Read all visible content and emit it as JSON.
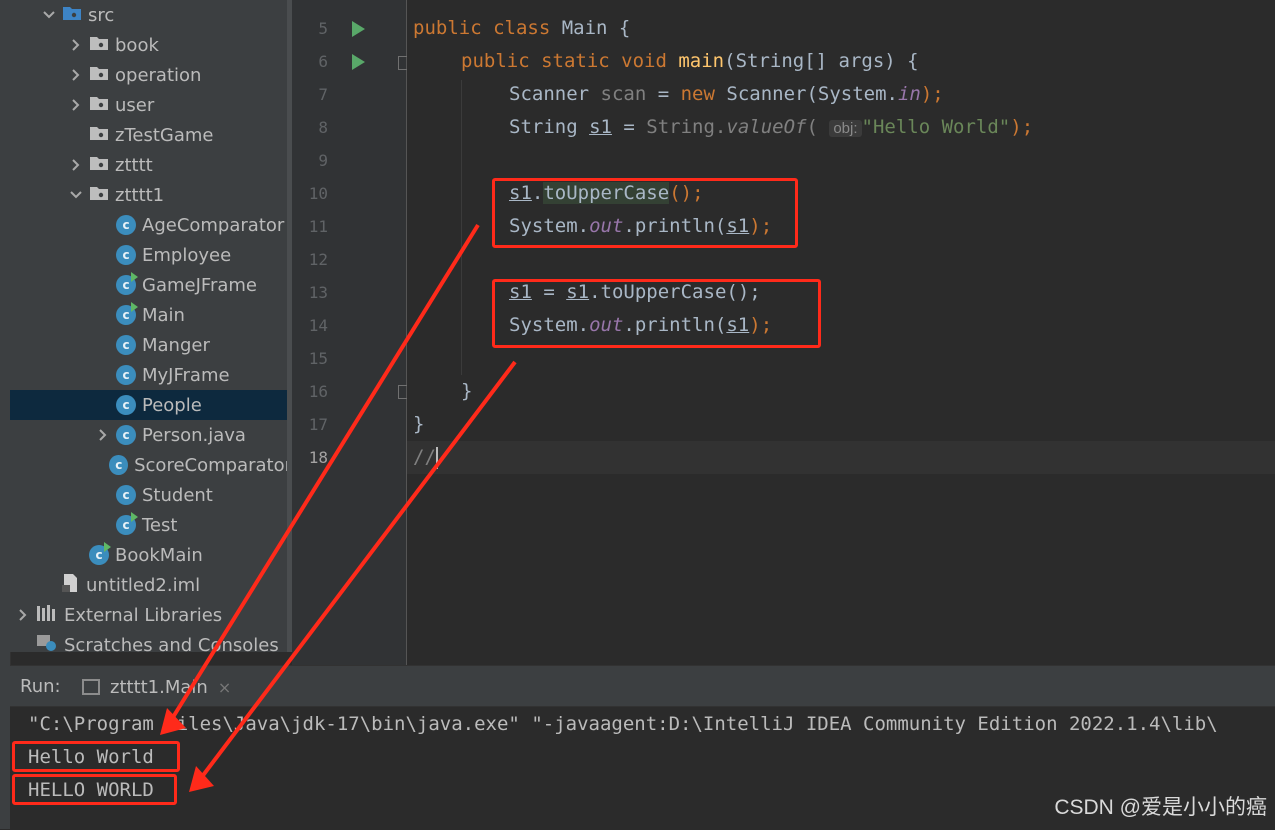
{
  "project_tree": [
    {
      "label": "src",
      "type": "folder",
      "expanded": true,
      "depth": 1
    },
    {
      "label": "book",
      "type": "package",
      "expanded": false,
      "depth": 2
    },
    {
      "label": "operation",
      "type": "package",
      "expanded": false,
      "depth": 2
    },
    {
      "label": "user",
      "type": "package",
      "expanded": false,
      "depth": 2
    },
    {
      "label": "zTestGame",
      "type": "package",
      "expanded": null,
      "depth": 2
    },
    {
      "label": "ztttt",
      "type": "package",
      "expanded": false,
      "depth": 2
    },
    {
      "label": "ztttt1",
      "type": "package",
      "expanded": true,
      "depth": 2
    },
    {
      "label": "AgeComparator",
      "type": "class",
      "depth": 3
    },
    {
      "label": "Employee",
      "type": "class",
      "depth": 3
    },
    {
      "label": "GameJFrame",
      "type": "class-main",
      "depth": 3
    },
    {
      "label": "Main",
      "type": "class-main",
      "depth": 3
    },
    {
      "label": "Manger",
      "type": "class",
      "depth": 3
    },
    {
      "label": "MyJFrame",
      "type": "class",
      "depth": 3
    },
    {
      "label": "People",
      "type": "class",
      "depth": 3,
      "selected": true
    },
    {
      "label": "Person.java",
      "type": "class",
      "expanded": false,
      "depth": 3
    },
    {
      "label": "ScoreComparator",
      "type": "class",
      "depth": 3
    },
    {
      "label": "Student",
      "type": "class",
      "depth": 3
    },
    {
      "label": "Test",
      "type": "class-main",
      "depth": 3
    },
    {
      "label": "BookMain",
      "type": "class-main",
      "depth": 2
    },
    {
      "label": "untitled2.iml",
      "type": "file",
      "depth": 1
    },
    {
      "label": "External Libraries",
      "type": "libraries",
      "expanded": false,
      "depth": 0
    },
    {
      "label": "Scratches and Consoles",
      "type": "scratches",
      "depth": 0
    }
  ],
  "editor": {
    "line_numbers": [
      "5",
      "6",
      "7",
      "8",
      "9",
      "10",
      "11",
      "12",
      "13",
      "14",
      "15",
      "16",
      "17",
      "18"
    ],
    "current_line": "18",
    "code": {
      "l5_kw": "public class",
      "l5_rest": " Main {",
      "l6_kw": "public static void",
      "l6_fn": "main",
      "l6_rest": "(String[] args) {",
      "l7_a": "Scanner ",
      "l7_var": "scan",
      "l7_b": " = ",
      "l7_new": "new",
      "l7_c": " Scanner(System.",
      "l7_in": "in",
      "l7_d": ");",
      "l8_a": "String ",
      "l8_s1": "s1",
      "l8_b": " = ",
      "l8_c": "String.",
      "l8_fn": "valueOf",
      "l8_d": "( ",
      "l8_hint": "obj:",
      "l8_str": "\"Hello World\"",
      "l8_e": ");",
      "l10_s1": "s1",
      "l10_dot": ".",
      "l10_fn": "toUpperCase",
      "l10_end": "();",
      "l11_a": "System.",
      "l11_out": "out",
      "l11_b": ".println(",
      "l11_s1": "s1",
      "l11_c": ");",
      "l13_s1a": "s1",
      "l13_a": " = ",
      "l13_s1b": "s1",
      "l13_b": ".toUpperCase();",
      "l14_a": "System.",
      "l14_out": "out",
      "l14_b": ".println(",
      "l14_s1": "s1",
      "l14_c": ");",
      "l16": "}",
      "l17": "}",
      "l18": "//"
    }
  },
  "run_panel": {
    "label": "Run:",
    "tab_title": "ztttt1.Main",
    "tab_close": "×",
    "console": [
      "\"C:\\Program Files\\Java\\jdk-17\\bin\\java.exe\" \"-javaagent:D:\\IntelliJ IDEA Community Edition 2022.1.4\\lib\\",
      "Hello World",
      "HELLO WORLD"
    ]
  },
  "watermark": "CSDN @爱是小小的癌",
  "colors": {
    "annotation_red": "#ff2a1a",
    "keyword": "#cc7832",
    "function": "#ffc66d",
    "string": "#6a8759"
  }
}
